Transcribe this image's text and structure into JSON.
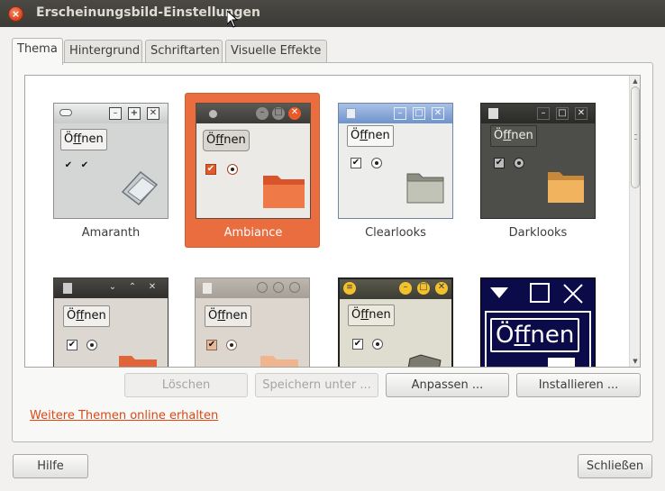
{
  "window": {
    "title": "Erscheinungsbild-Einstellungen",
    "close_glyph": "×"
  },
  "tabs": [
    {
      "label": "Thema"
    },
    {
      "label": "Hintergrund"
    },
    {
      "label": "Schriftarten"
    },
    {
      "label": "Visuelle Effekte"
    }
  ],
  "themes": [
    {
      "name": "Amaranth",
      "open_pre": "Ö",
      "open_u": "f",
      "open_post": "fnen"
    },
    {
      "name": "Ambiance",
      "open_pre": "Ö",
      "open_u": "f",
      "open_post": "fnen"
    },
    {
      "name": "Clearlooks",
      "open_pre": "Ö",
      "open_u": "f",
      "open_post": "fnen"
    },
    {
      "name": "Darklooks",
      "open_pre": "Ö",
      "open_u": "f",
      "open_post": "fnen"
    },
    {
      "name": "",
      "open_pre": "Ö",
      "open_u": "f",
      "open_post": "fnen"
    },
    {
      "name": "",
      "open_pre": "Ö",
      "open_u": "f",
      "open_post": "fnen"
    },
    {
      "name": "",
      "open_pre": "Ö",
      "open_u": "f",
      "open_post": "fnen"
    },
    {
      "name": "",
      "open_pre": "Ö",
      "open_u": "f",
      "open_post": "fnen"
    }
  ],
  "selected_theme": "Ambiance",
  "actions": {
    "delete": "Löschen",
    "save_as": "Speichern unter ...",
    "customize": "Anpassen ...",
    "install": "Installieren ..."
  },
  "link": "Weitere Themen online erhalten",
  "footer": {
    "help": "Hilfe",
    "close": "Schließen"
  },
  "colors": {
    "accent": "#e96d3e",
    "link": "#dd4814",
    "titlebar": "#3c3b37"
  }
}
